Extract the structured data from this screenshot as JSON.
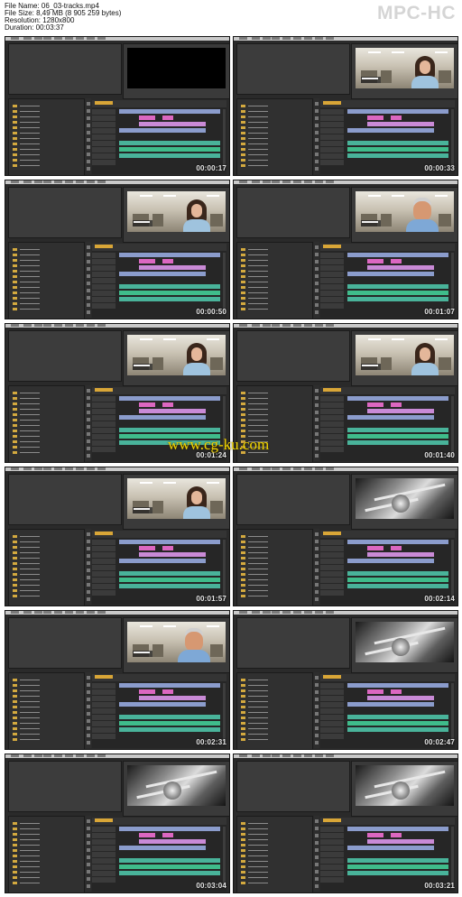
{
  "header": {
    "file_name": "File Name: 06_03-tracks.mp4",
    "file_size": "File Size: 8,49 MB (8 905 259 bytes)",
    "resolution": "Resolution: 1280x800",
    "duration": "Duration: 00:03:37",
    "brand": "MPC-HC"
  },
  "thumbnails": [
    {
      "time": "00:00:17",
      "scene": "black"
    },
    {
      "time": "00:00:33",
      "scene": "woman"
    },
    {
      "time": "00:00:50",
      "scene": "woman"
    },
    {
      "time": "00:01:07",
      "scene": "man"
    },
    {
      "time": "00:01:24",
      "scene": "woman"
    },
    {
      "time": "00:01:40",
      "scene": "woman"
    },
    {
      "time": "00:01:57",
      "scene": "woman"
    },
    {
      "time": "00:02:14",
      "scene": "bw"
    },
    {
      "time": "00:02:31",
      "scene": "man"
    },
    {
      "time": "00:02:47",
      "scene": "bw"
    },
    {
      "time": "00:03:04",
      "scene": "bw"
    },
    {
      "time": "00:03:21",
      "scene": "bw"
    }
  ],
  "watermark": "www.cg-ku.com",
  "colors": {
    "timecode_accent": "#d9a637",
    "clip_video": "#8b9ccc",
    "clip_title": "#c98ad6",
    "clip_audio": "#49b39a"
  }
}
